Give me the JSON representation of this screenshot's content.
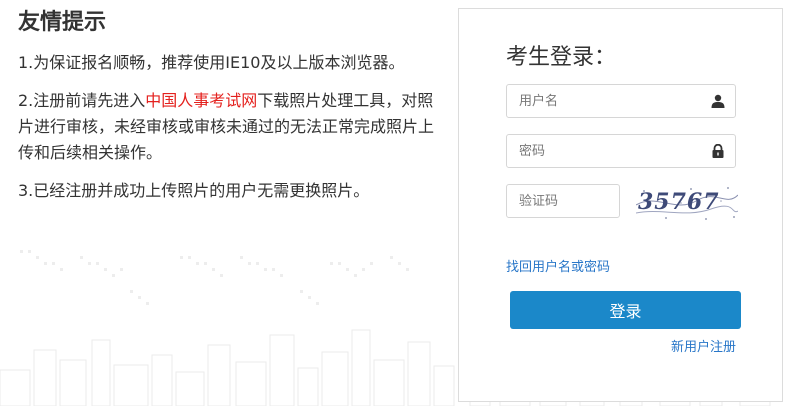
{
  "tips": {
    "title": "友情提示",
    "tip1": "1.为保证报名顺畅，推荐使用IE10及以上版本浏览器。",
    "tip2_before": "2.注册前请先进入",
    "tip2_link": "中国人事考试网",
    "tip2_after": "下载照片处理工具，对照片进行审核，未经审核或审核未通过的无法正常完成照片上传和后续相关操作。",
    "tip3": "3.已经注册并成功上传照片的用户无需更换照片。"
  },
  "login": {
    "title": "考生登录：",
    "username_placeholder": "用户名",
    "password_placeholder": "密码",
    "captcha_placeholder": "验证码",
    "captcha_text": "35767",
    "forgot_link": "找回用户名或密码",
    "login_button": "登录",
    "register_link": "新用户注册",
    "username_icon": "user-icon",
    "password_icon": "lock-icon"
  },
  "colors": {
    "accent": "#1b88c9",
    "link": "#2876c8",
    "highlight_link": "#e4211e"
  }
}
